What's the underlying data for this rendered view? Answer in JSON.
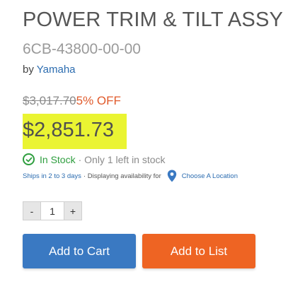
{
  "product": {
    "title": "POWER TRIM & TILT ASSY",
    "part_number": "6CB-43800-00-00",
    "by_label": "by",
    "brand": "Yamaha"
  },
  "pricing": {
    "old_price": "$3,017.70",
    "discount": "5% OFF",
    "price": "$2,851.73",
    "highlight_color": "#eaf432"
  },
  "stock": {
    "status": "In Stock",
    "note": "· Only 1 left in stock",
    "status_color": "#2e9e3e"
  },
  "shipping": {
    "ships_text": "Ships in 2 to 3 days",
    "availability_text": "· Displaying availability for",
    "location_link": "Choose A Location",
    "icon": "map-pin-icon"
  },
  "quantity": {
    "minus_label": "-",
    "value": "1",
    "plus_label": "+"
  },
  "actions": {
    "add_to_cart": "Add to Cart",
    "add_to_list": "Add to List",
    "cart_color": "#3a79c2",
    "list_color": "#ee6423"
  }
}
